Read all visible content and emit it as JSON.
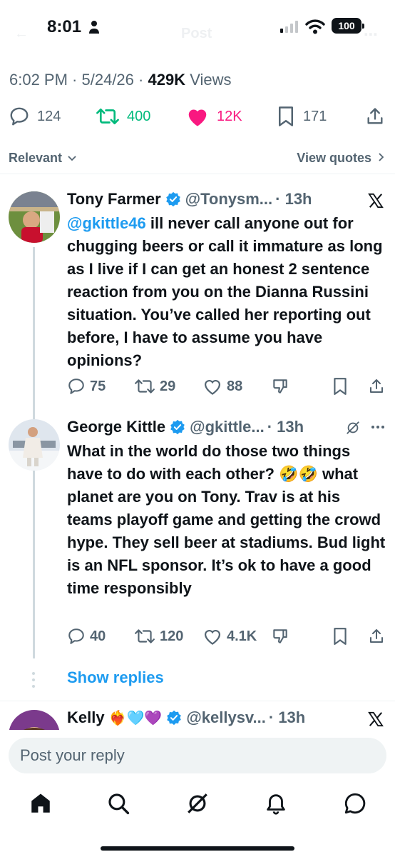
{
  "status_bar": {
    "time": "8:01",
    "battery": "100",
    "header_title": "Post"
  },
  "tweet": {
    "time": "6:02 PM",
    "date": "5/24/26",
    "views_count": "429K",
    "views_label": "Views",
    "stats": {
      "replies": "124",
      "reposts": "400",
      "likes": "12K",
      "bookmarks": "171"
    },
    "colors": {
      "repost": "#00ba7c",
      "like": "#f91880",
      "link": "#1d9bf0",
      "verified": "#1d9bf0"
    }
  },
  "sort": {
    "relevant_label": "Relevant",
    "view_quotes_label": "View quotes"
  },
  "replies": [
    {
      "name": "Tony Farmer",
      "handle": "@Tonysm...",
      "age": "· 13h",
      "mention": "@gkittle46",
      "text": "ill never call anyone out for chugging beers or call it immature as long as I live if I can get an honest 2 sentence reaction from you on the Dianna Russini situation. You’ve called her reporting out before, I have to assume you have opinions?",
      "reply_count": "75",
      "repost_count": "29",
      "like_count": "88"
    },
    {
      "name": "George Kittle",
      "handle": "@gkittle...",
      "age": "· 13h",
      "text_before_emoji": "What in the world do those two things have to do with each other?",
      "emoji": "🤣🤣",
      "text_after_emoji": "what planet are you on Tony. Trav is at his teams playoff game and getting the crowd hype. They sell beer at stadiums. Bud light is an NFL sponsor. It’s ok to have a good time responsibly",
      "reply_count": "40",
      "repost_count": "120",
      "like_count": "4.1K",
      "show_replies_label": "Show replies"
    },
    {
      "name": "Kelly",
      "name_emoji": "❤️‍🔥🩵💜",
      "handle": "@kellysv...",
      "age": "· 13h"
    }
  ],
  "composer": {
    "placeholder": "Post your reply"
  },
  "tab_bar": {
    "items": [
      "home-icon",
      "search-icon",
      "grok-icon",
      "notifications-icon",
      "messages-icon"
    ]
  }
}
